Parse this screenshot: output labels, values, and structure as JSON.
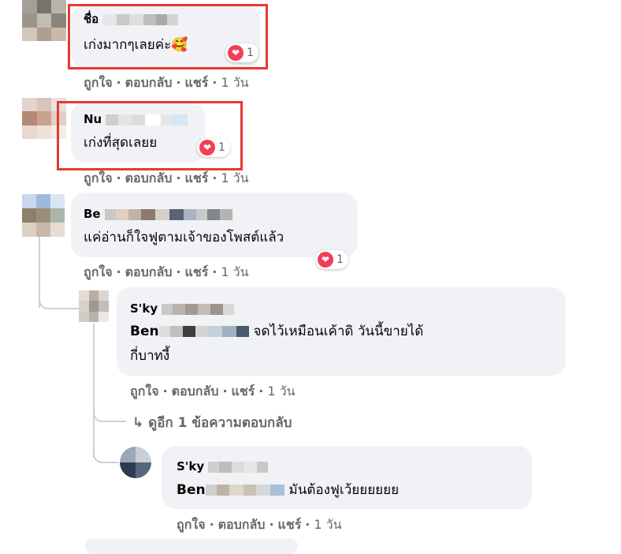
{
  "action_labels": {
    "like": "ถูกใจ",
    "reply": "ตอบกลับ",
    "share": "แชร์"
  },
  "comments": [
    {
      "name": "ชื่อ",
      "text": "เก่งมากๆเลยค่ะ🥰",
      "time": "1 วัน",
      "reaction_count": "1"
    },
    {
      "name": "Nu",
      "text": "เก่งที่สุดเลยย",
      "time": "1 วัน",
      "reaction_count": "1"
    },
    {
      "name": "Be",
      "text": "แค่อ่านก็ใจฟูตามเจ้าของโพสต์แล้ว",
      "time": "1 วัน",
      "reaction_count": "1"
    },
    {
      "name": "S'ky",
      "text_prefix": "Ben",
      "text_rest": "จดไว้เหมือนเค้าดิ วันนี้ขายได้",
      "text_line2": "กี่บาทงี้",
      "time": "1 วัน"
    },
    {
      "name": "S'ky",
      "text_prefix": "Ben",
      "text_rest": "มันต้องฟูเว้ยยยยยย",
      "time": "1 วัน"
    }
  ],
  "view_more": {
    "arrow": "↳",
    "label": "ดูอีก 1 ข้อความตอบกลับ"
  },
  "colors": {
    "bubble": "#f0f2f5",
    "highlight_box": "#e53935",
    "heart": "#f33e58",
    "meta": "#65676b"
  },
  "icons": {
    "reaction": "heart-reaction-icon"
  }
}
